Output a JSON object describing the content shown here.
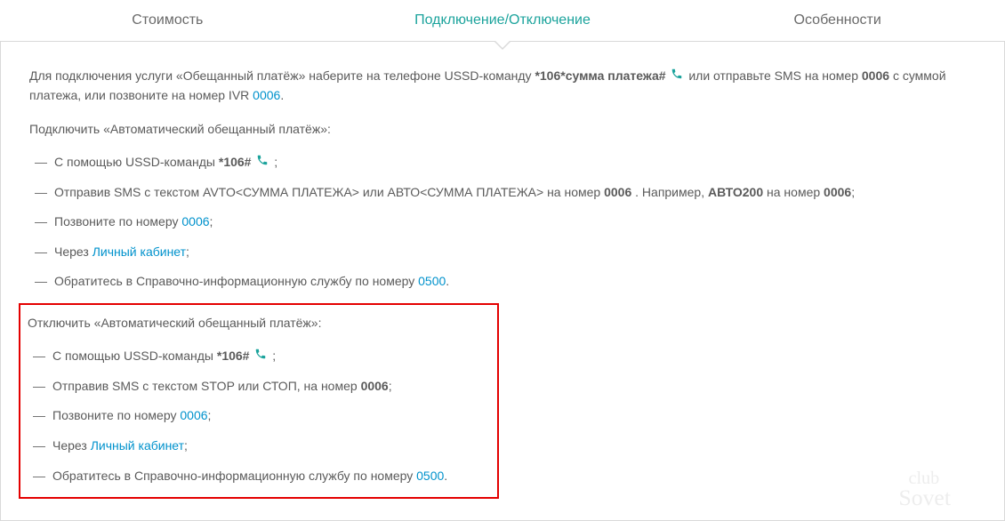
{
  "tabs": {
    "cost": "Стоимость",
    "connect": "Подключение/Отключение",
    "features": "Особенности"
  },
  "intro": {
    "p1a": "Для подключения услуги «Обещанный платёж» наберите на телефоне USSD-команду ",
    "ussd1": " *106*сумма платежа#",
    "p1b": " или отправьте SMS на номер ",
    "sms_num": "0006",
    "p1c": " с суммой платежа, или позвоните на номер IVR ",
    "ivr_link": "0006",
    "p1d": "."
  },
  "section_on": {
    "title": "Подключить «Автоматический обещанный платёж»:",
    "i1a": "С помощью USSD-команды ",
    "i1_ussd": " *106#",
    "i1b": " ;",
    "i2a": "Отправив SMS с текстом AVTO<СУММА ПЛАТЕЖА> или АВТО<СУММА ПЛАТЕЖА> на номер ",
    "i2_num": "0006",
    "i2b": ". Например, ",
    "i2_ex": "АВТО200",
    "i2c": " на номер ",
    "i2_num2": "0006",
    "i2d": ";",
    "i3a": "Позвоните по номеру ",
    "i3_link": "0006",
    "i3b": ";",
    "i4a": "Через ",
    "i4_link": "Личный кабинет",
    "i4b": ";",
    "i5a": "Обратитесь в Справочно-информационную службу по номеру ",
    "i5_link": "0500",
    "i5b": "."
  },
  "section_off": {
    "title": "Отключить «Автоматический обещанный платёж»:",
    "i1a": "С помощью USSD-команды ",
    "i1_ussd": " *106#",
    "i1b": " ;",
    "i2a": "Отправив SMS с текстом STOP или СТОП, на номер ",
    "i2_num": "0006",
    "i2b": ";",
    "i3a": "Позвоните по номеру ",
    "i3_link": "0006",
    "i3b": ";",
    "i4a": "Через ",
    "i4_link": "Личный кабинет",
    "i4b": ";",
    "i5a": "Обратитесь в Справочно-информационную службу по номеру ",
    "i5_link": "0500",
    "i5b": "."
  }
}
